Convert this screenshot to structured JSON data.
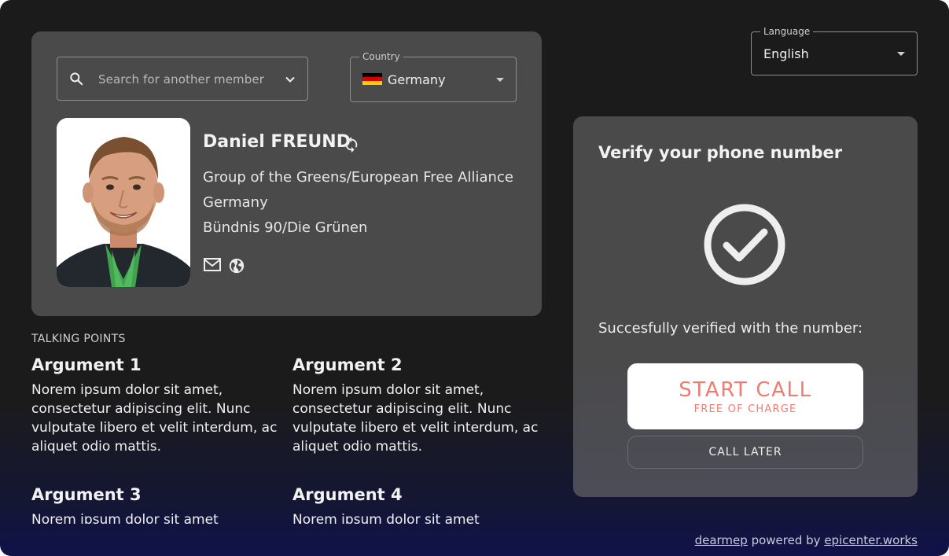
{
  "search": {
    "placeholder": "Search for another member"
  },
  "country": {
    "label": "Country",
    "value": "Germany",
    "flag_colors": [
      "#000000",
      "#dd0000",
      "#ffce00"
    ]
  },
  "language": {
    "label": "Language",
    "value": "English"
  },
  "mep": {
    "name": "Daniel FREUND",
    "group": "Group of the Greens/European Free Alliance",
    "country": "Germany",
    "party": "Bündnis 90/Die Grünen",
    "contact_icons": [
      "mail-icon",
      "globe-icon"
    ]
  },
  "talking_points": {
    "heading": "TALKING POINTS",
    "items": [
      {
        "title": "Argument 1",
        "text": "Norem ipsum dolor sit amet, consectetur adipiscing elit. Nunc vulputate libero et velit interdum, ac aliquet odio mattis."
      },
      {
        "title": "Argument 2",
        "text": "Norem ipsum dolor sit amet, consectetur adipiscing elit. Nunc vulputate libero et velit interdum, ac aliquet odio mattis."
      },
      {
        "title": "Argument 3",
        "text": "Norem ipsum dolor sit amet"
      },
      {
        "title": "Argument 4",
        "text": "Norem ipsum dolor sit amet"
      }
    ]
  },
  "verify": {
    "title": "Verify your phone number",
    "status_icon": "check-circle-icon",
    "message": "Succesfully verified with the number:",
    "start_call": "START CALL",
    "start_call_sub": "FREE OF CHARGE",
    "call_later": "CALL LATER",
    "accent_color": "#f07b6e"
  },
  "footer": {
    "brand": "dearmep",
    "powered_by": "powered by",
    "org": "epicenter.works"
  }
}
